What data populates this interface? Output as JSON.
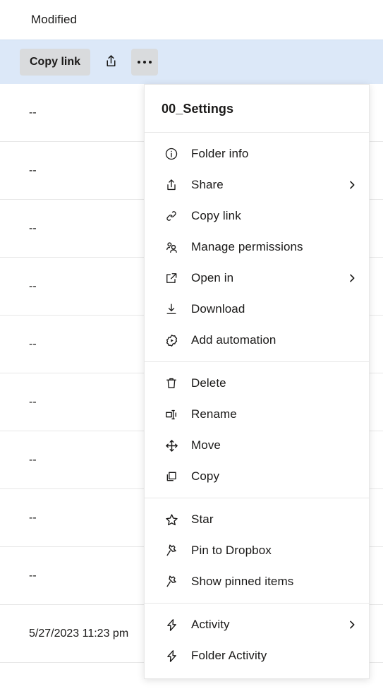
{
  "table": {
    "column_header": "Modified",
    "rows": [
      {
        "modified": "--"
      },
      {
        "modified": "--"
      },
      {
        "modified": "--"
      },
      {
        "modified": "--"
      },
      {
        "modified": "--"
      },
      {
        "modified": "--"
      },
      {
        "modified": "--"
      },
      {
        "modified": "--"
      },
      {
        "modified": "--"
      },
      {
        "modified": "5/27/2023 11:23 pm"
      }
    ]
  },
  "action_bar": {
    "copy_link_label": "Copy link",
    "share_icon": "share-upload-icon",
    "more_icon": "ellipsis-icon",
    "background_color": "#dce8f8",
    "button_color": "#d9dbdd"
  },
  "context_menu": {
    "title": "00_Settings",
    "groups": [
      {
        "items": [
          {
            "label": "Folder info",
            "icon": "info-circle-icon",
            "submenu": false
          },
          {
            "label": "Share",
            "icon": "share-upload-icon",
            "submenu": true
          },
          {
            "label": "Copy link",
            "icon": "link-icon",
            "submenu": false
          },
          {
            "label": "Manage permissions",
            "icon": "people-icon",
            "submenu": false
          },
          {
            "label": "Open in",
            "icon": "open-external-icon",
            "submenu": true
          },
          {
            "label": "Download",
            "icon": "download-icon",
            "submenu": false
          },
          {
            "label": "Add automation",
            "icon": "gear-play-icon",
            "submenu": false
          }
        ]
      },
      {
        "items": [
          {
            "label": "Delete",
            "icon": "trash-icon",
            "submenu": false
          },
          {
            "label": "Rename",
            "icon": "rename-icon",
            "submenu": false
          },
          {
            "label": "Move",
            "icon": "move-arrows-icon",
            "submenu": false
          },
          {
            "label": "Copy",
            "icon": "copy-icon",
            "submenu": false
          }
        ]
      },
      {
        "items": [
          {
            "label": "Star",
            "icon": "star-icon",
            "submenu": false
          },
          {
            "label": "Pin to Dropbox",
            "icon": "pin-icon",
            "submenu": false
          },
          {
            "label": "Show pinned items",
            "icon": "pin-icon",
            "submenu": false
          }
        ]
      },
      {
        "items": [
          {
            "label": "Activity",
            "icon": "lightning-icon",
            "submenu": true
          },
          {
            "label": "Folder Activity",
            "icon": "lightning-icon",
            "submenu": false
          }
        ]
      }
    ]
  }
}
